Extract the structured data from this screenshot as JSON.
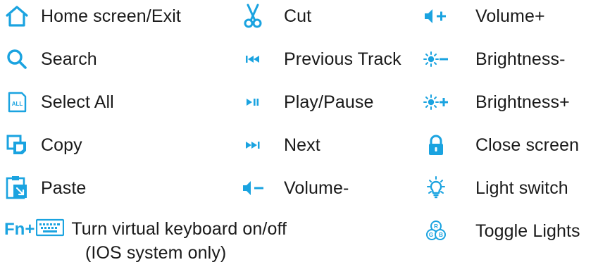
{
  "colors": {
    "accent": "#1aa3e0",
    "text": "#1a1a1a"
  },
  "column1": [
    {
      "icon": "home-icon",
      "label": "Home screen/Exit"
    },
    {
      "icon": "search-icon",
      "label": "Search"
    },
    {
      "icon": "select-all-icon",
      "badge": "ALL",
      "label": "Select All"
    },
    {
      "icon": "copy-icon",
      "label": "Copy"
    },
    {
      "icon": "paste-icon",
      "label": "Paste"
    }
  ],
  "column2": [
    {
      "icon": "scissors-icon",
      "label": "Cut"
    },
    {
      "icon": "previous-track-icon",
      "label": "Previous Track"
    },
    {
      "icon": "play-pause-icon",
      "label": "Play/Pause"
    },
    {
      "icon": "next-track-icon",
      "label": "Next"
    },
    {
      "icon": "volume-down-icon",
      "label": "Volume-"
    }
  ],
  "column3": [
    {
      "icon": "volume-up-icon",
      "label": "Volume+"
    },
    {
      "icon": "brightness-down-icon",
      "label": "Brightness-"
    },
    {
      "icon": "brightness-up-icon",
      "label": "Brightness+"
    },
    {
      "icon": "lock-icon",
      "label": "Close screen"
    },
    {
      "icon": "light-bulb-icon",
      "label": "Light switch"
    },
    {
      "icon": "rgb-lights-icon",
      "badges": [
        "R",
        "G",
        "B"
      ],
      "label": "Toggle Lights"
    }
  ],
  "virtual_keyboard": {
    "prefix": "Fn+",
    "icon": "keyboard-icon",
    "label": "Turn virtual keyboard on/off",
    "note": "(IOS system only)"
  }
}
